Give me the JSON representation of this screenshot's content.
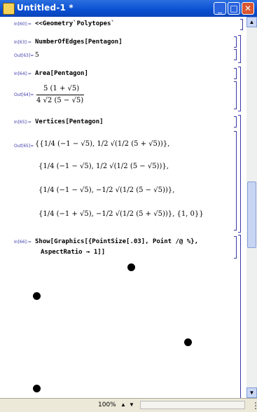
{
  "window": {
    "title": "Untitled-1 *"
  },
  "cells": {
    "c1": {
      "in_label": "In[60]:=",
      "input": "<<Geometry`Polytopes`"
    },
    "c2": {
      "in_label": "In[63]:=",
      "input": "NumberOfEdges[Pentagon]",
      "out_label": "Out[63]=",
      "output": "5"
    },
    "c3": {
      "in_label": "In[64]:=",
      "input": "Area[Pentagon]",
      "out_label": "Out[64]=",
      "num": "5 (1 + √5)",
      "den": "4 √2 (5 − √5)"
    },
    "c4": {
      "in_label": "In[65]:=",
      "input": "Vertices[Pentagon]",
      "out_label": "Out[65]=",
      "rows": [
        "{{1/4 (−1 − √5),  1/2 √(1/2 (5 + √5))},",
        "{1/4 (−1 − √5),  1/2 √(1/2 (5 − √5))},",
        "{1/4 (−1 − √5),  −1/2 √(1/2 (5 − √5))},",
        "{1/4 (−1 + √5),  −1/2 √(1/2 (5 + √5))},  {1, 0}}"
      ]
    },
    "c5": {
      "in_label": "In[66]:=",
      "input_line1": "Show[Graphics[{PointSize[.03], Point /@ %},",
      "input_line2": "AspectRatio → 1]]"
    }
  },
  "status": {
    "zoom": "100%"
  }
}
